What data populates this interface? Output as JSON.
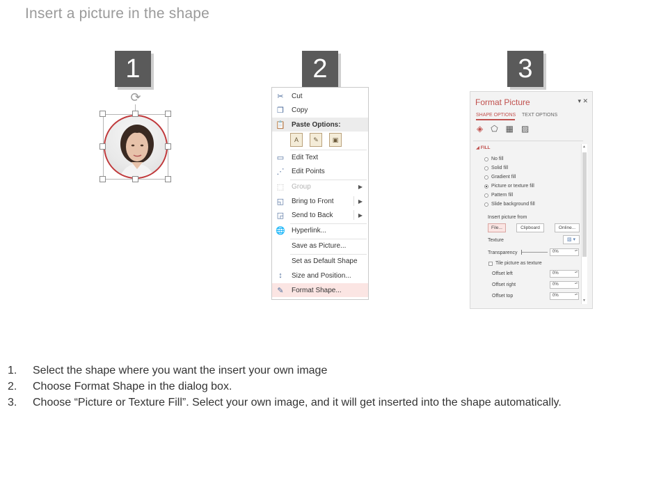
{
  "slide": {
    "title": "Insert a picture in the shape"
  },
  "badges": [
    "1",
    "2",
    "3"
  ],
  "context_menu": {
    "items": [
      {
        "icon": "scissors-icon",
        "glyph": "✂",
        "label": "Cut",
        "disabled": false
      },
      {
        "icon": "copy-icon",
        "glyph": "❐",
        "label": "Copy",
        "disabled": false
      },
      {
        "icon": "paste-icon",
        "glyph": "📋",
        "label": "Paste Options:",
        "header": true
      },
      {
        "icon": "edit-text-icon",
        "glyph": "▭",
        "label": "Edit Text",
        "disabled": false
      },
      {
        "icon": "edit-points-icon",
        "glyph": "⋰",
        "label": "Edit Points",
        "disabled": false
      },
      {
        "icon": "group-icon",
        "glyph": "⬚",
        "label": "Group",
        "disabled": true,
        "submenu": true
      },
      {
        "icon": "bring-to-front-icon",
        "glyph": "◱",
        "label": "Bring to Front",
        "disabled": false,
        "submenu": true
      },
      {
        "icon": "send-to-back-icon",
        "glyph": "◲",
        "label": "Send to Back",
        "disabled": false,
        "submenu": true
      },
      {
        "icon": "hyperlink-icon",
        "glyph": "🌐",
        "label": "Hyperlink...",
        "disabled": false
      },
      {
        "icon": "",
        "glyph": "",
        "label": "Save as Picture...",
        "disabled": false
      },
      {
        "icon": "",
        "glyph": "",
        "label": "Set as Default Shape",
        "disabled": false
      },
      {
        "icon": "size-position-icon",
        "glyph": "↕",
        "label": "Size and Position...",
        "disabled": false
      },
      {
        "icon": "format-shape-icon",
        "glyph": "✎",
        "label": "Format Shape...",
        "disabled": false,
        "highlight": true
      }
    ]
  },
  "format_pane": {
    "title": "Format Picture",
    "close": "▾ ✕",
    "tabs": [
      "SHAPE OPTIONS",
      "TEXT OPTIONS"
    ],
    "section": "◢ FILL",
    "fill_options": [
      "No fill",
      "Solid fill",
      "Gradient fill",
      "Picture or texture fill",
      "Pattern fill",
      "Slide background fill"
    ],
    "selected_fill": "Picture or texture fill",
    "insert_from_label": "Insert picture from",
    "buttons": {
      "file": "File...",
      "clipboard": "Clipboard",
      "online": "Online..."
    },
    "texture_label": "Texture",
    "transparency_label": "Transparency",
    "transparency_value": "0%",
    "tile_label": "Tile picture as texture",
    "offsets": [
      {
        "label": "Offset left",
        "value": "0%"
      },
      {
        "label": "Offset right",
        "value": "0%"
      },
      {
        "label": "Offset top",
        "value": "0%"
      }
    ]
  },
  "instructions": [
    {
      "num": "1.",
      "text": "Select the shape where you want the insert your own image"
    },
    {
      "num": "2.",
      "text": "Choose Format Shape in the dialog box."
    },
    {
      "num": "3.",
      "text": "Choose “Picture or Texture Fill”. Select your own image, and it will get inserted into the shape automatically."
    }
  ]
}
